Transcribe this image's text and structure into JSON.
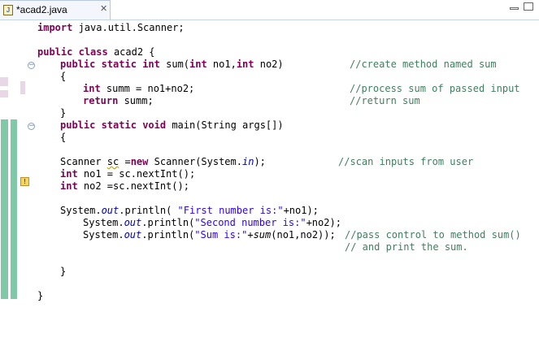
{
  "tab": {
    "title": "*acad2.java",
    "icon": "java-file-icon",
    "close": "✕"
  },
  "code": {
    "import_kw": "import",
    "import_rest": " java.util.Scanner;",
    "class_kw1": "public",
    "class_kw2": "class",
    "class_name": " acad2 {",
    "sum_kw1": "public",
    "sum_kw2": "static",
    "sum_kw3": "int",
    "sum_sig1": " sum(",
    "sum_kw4": "int",
    "sum_sig2": " no1,",
    "sum_kw5": "int",
    "sum_sig3": " no2)",
    "sum_comment": "//create method named sum",
    "brace_open": "{",
    "summ_kw": "int",
    "summ_rest": " summ = no1+no2;",
    "summ_comment": "//process sum of passed input",
    "ret_kw": "return",
    "ret_rest": " summ;",
    "ret_comment": "//return sum",
    "brace_close": "}",
    "main_kw1": "public",
    "main_kw2": "static",
    "main_kw3": "void",
    "main_sig": " main(String args[])",
    "scan_pre": "Scanner ",
    "scan_var": "sc",
    "scan_mid": " =",
    "scan_new": "new",
    "scan_rest": " Scanner(System.",
    "scan_in": "in",
    "scan_end": ");",
    "scan_comment": "//scan inputs from user",
    "no1_kw": "int",
    "no1_rest": " no1 = sc.nextInt();",
    "no2_kw": "int",
    "no2_rest": " no2 =sc.nextInt();",
    "p1_pre": "System.",
    "p1_out": "out",
    "p1_mid": ".println( ",
    "p1_str": "\"First number is:\"",
    "p1_end": "+no1);",
    "p2_pre": "System.",
    "p2_out": "out",
    "p2_mid": ".println(",
    "p2_str": "\"Second number is:\"",
    "p2_end": "+no2);",
    "p3_pre": "System.",
    "p3_out": "out",
    "p3_mid": ".println(",
    "p3_str": "\"Sum is:\"",
    "p3_plus": "+",
    "p3_sum": "sum",
    "p3_end": "(no1,no2));",
    "p3_comment": "//pass control to method sum()",
    "p4_comment": "// and print the sum."
  }
}
